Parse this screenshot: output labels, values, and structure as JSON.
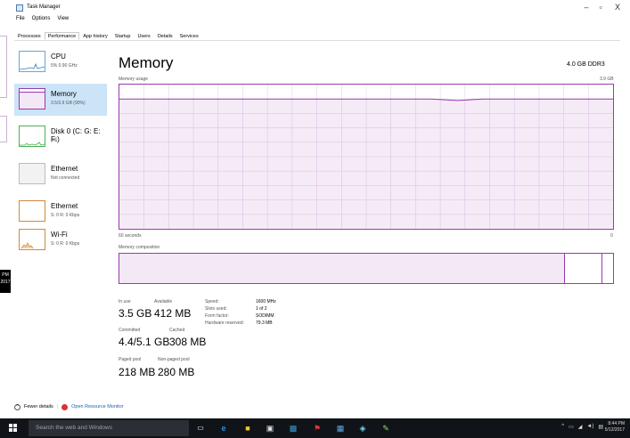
{
  "window": {
    "title": "Task Manager",
    "minimize": "–",
    "maximize": "▫",
    "close": "X"
  },
  "menu": [
    "File",
    "Options",
    "View"
  ],
  "tabs": [
    "Processes",
    "Performance",
    "App history",
    "Startup",
    "Users",
    "Details",
    "Services"
  ],
  "active_tab": "Performance",
  "sidebar": [
    {
      "label": "CPU",
      "sub": "5% 0.90 GHz",
      "color": "#6ba4d8"
    },
    {
      "label": "Memory",
      "sub": "3.5/3.9 GB (90%)",
      "color": "#9b38b0",
      "active": true
    },
    {
      "label": "Disk 0 (C: G: E: F:)",
      "sub": "3%",
      "color": "#4caf50"
    },
    {
      "label": "Ethernet",
      "sub": "Not connected",
      "color": "#bbbbbb"
    },
    {
      "label": "Ethernet",
      "sub": "S: 0 R: 0 Kbps",
      "color": "#d08a3a"
    },
    {
      "label": "Wi-Fi",
      "sub": "S: 0 R: 0 Kbps",
      "color": "#d08a3a"
    }
  ],
  "main": {
    "title": "Memory",
    "total": "4.0 GB DDR3",
    "usage_label": "Memory usage",
    "usage_max": "3.9 GB",
    "seconds_label": "60 seconds",
    "zero_label": "0",
    "composition_label": "Memory composition"
  },
  "stats": {
    "in_use_label": "In use",
    "in_use": "3.5 GB",
    "available_label": "Available",
    "available": "412 MB",
    "committed_label": "Committed",
    "committed": "4.4/5.1 GB",
    "cached_label": "Cached",
    "cached": "308 MB",
    "paged_label": "Paged pool",
    "paged": "218 MB",
    "nonpaged_label": "Non-paged pool",
    "nonpaged": "280 MB"
  },
  "details": [
    {
      "k": "Speed:",
      "v": "1600 MHz"
    },
    {
      "k": "Slots used:",
      "v": "1 of 2"
    },
    {
      "k": "Form factor:",
      "v": "SODIMM"
    },
    {
      "k": "Hardware reserved:",
      "v": "79.3 MB"
    }
  ],
  "footer": {
    "fewer": "Fewer details",
    "resmon": "Open Resource Monitor"
  },
  "taskbar": {
    "search_placeholder": "Search the web and Windows",
    "clock_time": "8:44 PM",
    "clock_date": "5/12/2017"
  },
  "bg_window": {
    "pm_text": "PM\n2017"
  },
  "memory_usage_series": [
    0.9,
    0.9,
    0.9,
    0.9,
    0.9,
    0.9,
    0.9,
    0.9,
    0.9,
    0.9,
    0.9,
    0.9,
    0.9,
    0.89,
    0.9,
    0.9,
    0.9,
    0.9,
    0.9,
    0.9
  ]
}
